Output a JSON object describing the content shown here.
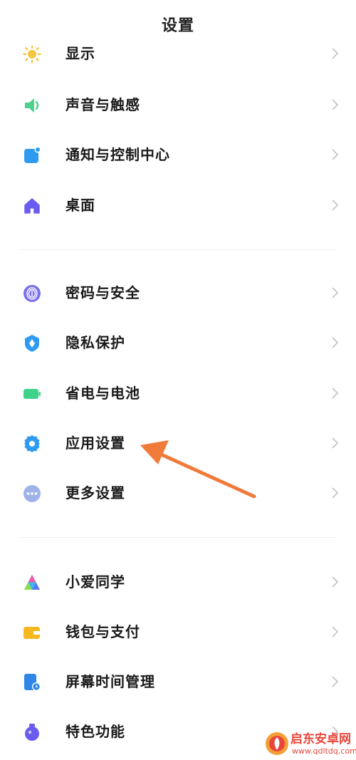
{
  "header": {
    "title": "设置"
  },
  "section1": [
    {
      "label": "显示",
      "icon": "sun-icon",
      "color": "#f7c542"
    },
    {
      "label": "声音与触感",
      "icon": "speaker-icon",
      "color": "#4fd18b"
    },
    {
      "label": "通知与控制中心",
      "icon": "notification-icon",
      "color": "#2f9bf0"
    },
    {
      "label": "桌面",
      "icon": "home-icon",
      "color": "#6b5cf0"
    }
  ],
  "section2": [
    {
      "label": "密码与安全",
      "icon": "fingerprint-icon",
      "color": "#7a6ff0"
    },
    {
      "label": "隐私保护",
      "icon": "privacy-shield-icon",
      "color": "#2f9bf0"
    },
    {
      "label": "省电与电池",
      "icon": "battery-icon",
      "color": "#3fd28a"
    },
    {
      "label": "应用设置",
      "icon": "gear-icon",
      "color": "#2f9bf0"
    },
    {
      "label": "更多设置",
      "icon": "more-dots-icon",
      "color": "#9fb3ea"
    }
  ],
  "section3": [
    {
      "label": "小爱同学",
      "icon": "xiaoai-icon",
      "color": "#3fb8f0"
    },
    {
      "label": "钱包与支付",
      "icon": "wallet-icon",
      "color": "#f5b820"
    },
    {
      "label": "屏幕时间管理",
      "icon": "screen-time-icon",
      "color": "#2f86e6"
    },
    {
      "label": "特色功能",
      "icon": "feature-icon",
      "color": "#6b5cf0"
    }
  ],
  "annotation": {
    "arrow_color": "#f07a3a",
    "points_to": "应用设置"
  },
  "watermark": {
    "name": "启东安卓网",
    "url": "www.qdltdq.com",
    "color": "#e8463a"
  }
}
